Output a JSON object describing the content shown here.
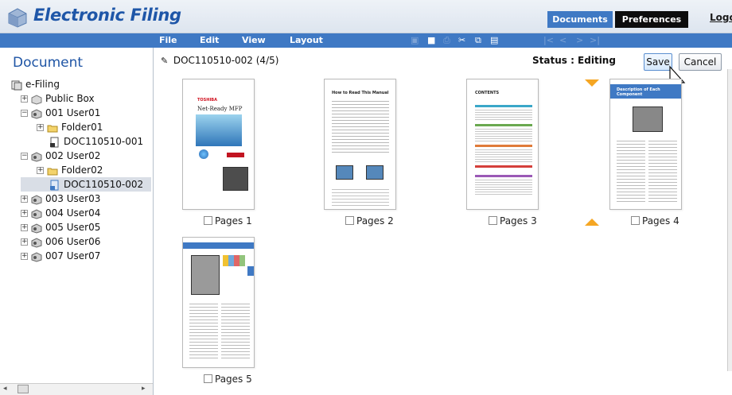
{
  "header": {
    "app_title": "Electronic Filing",
    "tabs": [
      "Documents",
      "Preferences"
    ],
    "logout_label": "Logout"
  },
  "menubar": {
    "items": [
      "File",
      "Edit",
      "View",
      "Layout"
    ]
  },
  "sidebar": {
    "title": "Document",
    "tree": [
      {
        "label": "e-Filing",
        "icon": "efiling-icon"
      },
      {
        "label": "Public Box",
        "icon": "public-box-icon",
        "expander": "+"
      },
      {
        "label": "001 User01",
        "icon": "user-box-icon",
        "expander": "-"
      },
      {
        "label": "Folder01",
        "icon": "folder-icon",
        "expander": "+"
      },
      {
        "label": "DOC110510-001",
        "icon": "document-icon"
      },
      {
        "label": "002 User02",
        "icon": "user-box-icon",
        "expander": "-"
      },
      {
        "label": "Folder02",
        "icon": "folder-icon",
        "expander": "+"
      },
      {
        "label": "DOC110510-002",
        "icon": "document-icon",
        "selected": true
      },
      {
        "label": "003 User03",
        "icon": "user-box-icon",
        "expander": "+"
      },
      {
        "label": "004 User04",
        "icon": "user-box-icon",
        "expander": "+"
      },
      {
        "label": "005 User05",
        "icon": "user-box-icon",
        "expander": "+"
      },
      {
        "label": "006 User06",
        "icon": "user-box-icon",
        "expander": "+"
      },
      {
        "label": "007 User07",
        "icon": "user-box-icon",
        "expander": "+"
      }
    ]
  },
  "main": {
    "doc_name": "DOC110510-002 (4/5)",
    "status": "Status : Editing",
    "save_label": "Save",
    "cancel_label": "Cancel",
    "pages": [
      {
        "label": "Pages 1",
        "thumb_title": "Net-Ready MFP",
        "brand": "TOSHIBA"
      },
      {
        "label": "Pages 2",
        "thumb_title": "How to Read This Manual"
      },
      {
        "label": "Pages 3",
        "thumb_title": "CONTENTS"
      },
      {
        "label": "Pages 4",
        "thumb_title": "Description of Each Component"
      },
      {
        "label": "Pages 5"
      }
    ]
  },
  "colors": {
    "accent": "#3f79c4",
    "brand_title": "#1e56a8",
    "move_arrow": "#f5a623"
  }
}
